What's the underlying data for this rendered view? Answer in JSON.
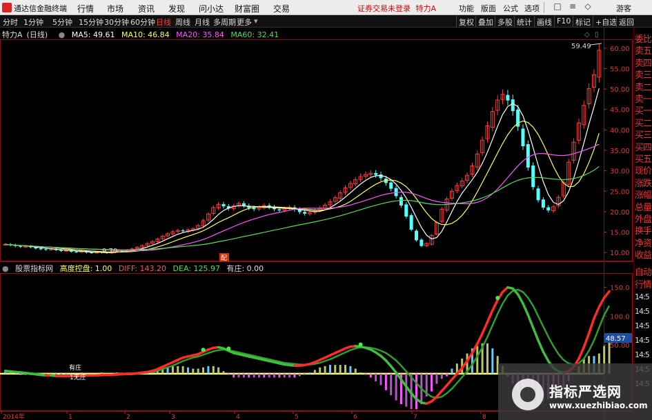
{
  "menubar": {
    "app_name": "通达信金融终端",
    "menus": [
      "行情",
      "市场",
      "资讯",
      "发现",
      "问小达",
      "财富圈",
      "交易"
    ],
    "login_warning": "证券交易未登录",
    "stock_title": "特力A",
    "tools": [
      "功能",
      "版面",
      "公式",
      "选项"
    ],
    "guest": "游客"
  },
  "periodbar": {
    "periods": [
      "分时",
      "1分钟",
      "5分钟",
      "15分钟",
      "30分钟",
      "60分钟",
      "日线",
      "周线",
      "月线",
      "多周期",
      "更多"
    ],
    "active_period": "日线",
    "right_buttons": [
      "复权",
      "叠加",
      "多股",
      "统计",
      "画线",
      "F10",
      "标记",
      "+自选",
      "返回"
    ]
  },
  "legend": {
    "stock": "特力A",
    "period": "(日线)",
    "ma5": "MA5: 49.61",
    "ma10": "MA10: 46.84",
    "ma20": "MA20: 35.84",
    "ma60": "MA60: 32.41"
  },
  "indicator": {
    "source": "股票指标网",
    "control": "高度控盘: 1.00",
    "diff": "DIFF: 143.20",
    "dea": "DEA: 125.97",
    "youzhuang": "有庄: 0.00",
    "label_youzhuang": "有庄",
    "label_wuzhuang": "1无庄"
  },
  "price_axis": [
    "60.00",
    "55.00",
    "50.00",
    "45.00",
    "40.00",
    "35.00",
    "30.00",
    "25.00",
    "20.00",
    "15.00",
    "10.00"
  ],
  "indicator_axis": [
    "150.0",
    "100.0",
    "50.00"
  ],
  "indicator_badge": "48.57",
  "annotations": {
    "high_price": "59.49",
    "low_price": "9.70",
    "event_marker": "配"
  },
  "time_axis": [
    "2014年",
    "1",
    "2",
    "3",
    "4",
    "5",
    "6",
    "7",
    "8"
  ],
  "right_panel": {
    "quote_tabs": [
      "委比",
      "卖五",
      "卖四",
      "卖三",
      "卖二",
      "卖一",
      "买一",
      "买二",
      "买三",
      "买四",
      "买五",
      "现价",
      "涨跌",
      "涨幅",
      "总量",
      "外盘",
      "换手",
      "净资",
      "收益"
    ],
    "bottom_tabs": [
      "自动",
      "行情"
    ],
    "times": [
      "14:5",
      "14:5",
      "14:5",
      "14:5",
      "14:5",
      "14:5",
      "14:5"
    ]
  },
  "watermark": {
    "title": "指标严选网",
    "url": "www.xuezhibiao.com"
  },
  "colors": {
    "ma5": "#ffffff",
    "ma10": "#ffff55",
    "ma20": "#ff55ff",
    "ma60": "#55dd55",
    "up": "#ff3b3b",
    "down": "#54ffff",
    "axis": "#cc2222"
  },
  "chart_data": {
    "type": "candlestick",
    "price_axis_range": [
      8,
      62
    ],
    "close_series": [
      12.0,
      11.8,
      11.6,
      11.4,
      11.5,
      11.3,
      11.0,
      10.8,
      10.7,
      10.9,
      10.6,
      10.4,
      10.5,
      10.2,
      10.1,
      10.3,
      10.0,
      9.9,
      10.1,
      10.0,
      9.9,
      10.2,
      10.4,
      10.3,
      10.6,
      10.9,
      11.3,
      11.7,
      12.2,
      12.7,
      13.3,
      14.0,
      14.6,
      15.1,
      15.4,
      15.2,
      15.5,
      15.8,
      16.6,
      17.8,
      19.4,
      21.0,
      21.8,
      21.3,
      20.8,
      21.4,
      22.0,
      21.5,
      20.9,
      20.6,
      21.0,
      21.5,
      21.1,
      20.6,
      20.3,
      20.7,
      21.1,
      20.5,
      19.9,
      19.5,
      19.8,
      20.3,
      20.9,
      21.6,
      22.4,
      23.4,
      24.6,
      25.8,
      26.9,
      27.8,
      28.6,
      29.1,
      29.4,
      29.0,
      28.2,
      27.0,
      25.6,
      23.8,
      21.5,
      18.8,
      15.6,
      13.0,
      11.6,
      12.2,
      14.2,
      17.3,
      20.6,
      23.1,
      25.0,
      26.4,
      27.5,
      28.9,
      31.2,
      34.1,
      37.5,
      41.0,
      44.5,
      47.3,
      48.7,
      47.2,
      44.6,
      40.8,
      36.0,
      30.8,
      26.0,
      22.8,
      21.0,
      20.3,
      21.2,
      23.5,
      27.2,
      32.1,
      37.0,
      41.7,
      46.0,
      50.1,
      53.5,
      59.49
    ],
    "indicator_axis_range": [
      -60,
      170
    ],
    "diff_series": [
      5,
      4,
      3,
      2,
      1,
      0,
      -1,
      -2,
      -3,
      -3,
      -4,
      -4,
      -4,
      -4,
      -4,
      -3,
      -3,
      -3,
      -3,
      -2,
      -2,
      -2,
      -1,
      -1,
      0,
      0,
      1,
      2,
      3,
      5,
      8,
      12,
      16,
      20,
      24,
      28,
      30,
      32,
      34,
      38,
      42,
      45,
      46,
      44,
      40,
      36,
      34,
      32,
      30,
      28,
      26,
      24,
      22,
      20,
      18,
      16,
      15,
      14,
      14,
      15,
      17,
      20,
      24,
      28,
      32,
      36,
      40,
      44,
      47,
      48,
      47,
      45,
      42,
      37,
      31,
      23,
      13,
      2,
      -10,
      -22,
      -34,
      -44,
      -50,
      -52,
      -48,
      -40,
      -30,
      -20,
      -10,
      0,
      10,
      22,
      36,
      52,
      70,
      90,
      110,
      128,
      142,
      150,
      148,
      138,
      122,
      102,
      80,
      58,
      38,
      22,
      10,
      4,
      2,
      4,
      12,
      26,
      46,
      70,
      96,
      116,
      132,
      143
    ],
    "dea_series": [
      4,
      4,
      3,
      3,
      2,
      1,
      0,
      -1,
      -2,
      -2,
      -3,
      -3,
      -3,
      -4,
      -4,
      -4,
      -3,
      -3,
      -3,
      -3,
      -2,
      -2,
      -2,
      -1,
      -1,
      -1,
      0,
      1,
      2,
      3,
      5,
      8,
      11,
      14,
      18,
      22,
      25,
      28,
      30,
      33,
      36,
      39,
      41,
      42,
      41,
      39,
      37,
      35,
      33,
      31,
      29,
      27,
      25,
      23,
      21,
      19,
      18,
      17,
      16,
      16,
      16,
      17,
      19,
      22,
      25,
      29,
      33,
      37,
      41,
      44,
      46,
      46,
      45,
      43,
      40,
      36,
      30,
      23,
      14,
      4,
      -6,
      -16,
      -26,
      -34,
      -40,
      -42,
      -40,
      -34,
      -26,
      -16,
      -6,
      4,
      16,
      30,
      46,
      64,
      84,
      104,
      122,
      136,
      144,
      146,
      142,
      132,
      118,
      100,
      82,
      64,
      48,
      34,
      24,
      18,
      16,
      18,
      26,
      40,
      58,
      80,
      102,
      118
    ],
    "histogram": [
      2,
      1,
      1,
      -1,
      -1,
      -1,
      -1,
      -1,
      -1,
      -1,
      -1,
      -1,
      -1,
      0,
      0,
      1,
      0,
      0,
      0,
      1,
      0,
      0,
      1,
      0,
      1,
      1,
      1,
      1,
      1,
      2,
      3,
      4,
      5,
      6,
      6,
      6,
      5,
      4,
      4,
      5,
      6,
      6,
      5,
      2,
      -1,
      -3,
      -3,
      -3,
      -3,
      -3,
      -3,
      -3,
      -3,
      -3,
      -3,
      -3,
      -3,
      -3,
      -2,
      -1,
      1,
      3,
      5,
      6,
      7,
      7,
      7,
      7,
      6,
      4,
      1,
      -1,
      -3,
      -6,
      -9,
      -13,
      -17,
      -21,
      -24,
      -26,
      -28,
      -28,
      -24,
      -18,
      -14,
      -8,
      -4,
      -2,
      4,
      8,
      12,
      16,
      20,
      22,
      24,
      24,
      20,
      14,
      6,
      -2,
      -8,
      -14,
      -20,
      -22,
      -24,
      -24,
      -22,
      -20,
      -16,
      -14,
      -12,
      -6,
      0,
      6,
      12,
      14,
      14,
      16,
      22,
      25
    ]
  }
}
